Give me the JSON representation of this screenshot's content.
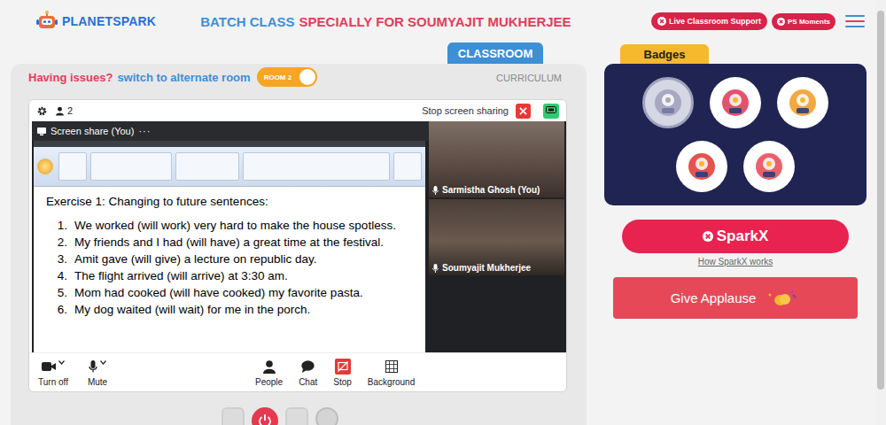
{
  "header": {
    "logo": "PLANETSPARK",
    "title": [
      {
        "text": "BATCH CLASS",
        "color": "#3d8fd6"
      },
      {
        "text": "SPECIALLY FOR SOUMYAJIT MUKHERJEE",
        "color": "#e23d5c"
      }
    ],
    "support_button": "Live Classroom Support",
    "moments_button": "PS Moments"
  },
  "tabs": [
    {
      "label": "CLASSROOM",
      "selected": true
    },
    {
      "label": "CURRICULUM",
      "selected": false
    }
  ],
  "room_switch": {
    "prompt": "Having issues?",
    "link": "switch to alternate room",
    "toggle_label": "ROOM 2",
    "on": true
  },
  "call": {
    "participants_count": "2",
    "share_action": "Stop screen sharing",
    "share_label": "Screen share (You)",
    "share_menu": "···",
    "document": {
      "heading": "Exercise 1: Changing to future sentences:",
      "items": [
        {
          "number": "1.",
          "text": "We worked (will work) very hard to make the house spotless."
        },
        {
          "number": "2.",
          "text": "My friends and I had (will have) a great time at the festival."
        },
        {
          "number": "3.",
          "text": "Amit gave (will give) a lecture on republic day."
        },
        {
          "number": "4.",
          "text": "The flight arrived (will arrive) at 3:30 am."
        },
        {
          "number": "5.",
          "text": "Mom had cooked (will have cooked) my favorite pasta."
        },
        {
          "number": "6.",
          "text": "My dog waited (will wait) for me in the porch."
        }
      ]
    },
    "tiles": [
      {
        "name": "Sarmistha Ghosh (You)"
      },
      {
        "name": "Soumyajit Mukherjee"
      }
    ],
    "controls": [
      {
        "label": "Turn off",
        "kind": "dropdown"
      },
      {
        "label": "Mute",
        "kind": "dropdown"
      },
      {
        "label": "People",
        "kind": "plain"
      },
      {
        "label": "Chat",
        "kind": "plain"
      },
      {
        "label": "Stop",
        "kind": "alert"
      },
      {
        "label": "Background",
        "kind": "plain"
      }
    ]
  },
  "badges": {
    "title": "Badges",
    "items": [
      {
        "earned": false,
        "color": "#7a7aa0"
      },
      {
        "earned": true,
        "color": "#e0405e"
      },
      {
        "earned": true,
        "color": "#f0a030"
      },
      {
        "earned": true,
        "color": "#e2403c"
      },
      {
        "earned": true,
        "color": "#e8505c"
      }
    ]
  },
  "sparkx": {
    "button": "SparkX",
    "help_link": "How SparkX works"
  },
  "applause": {
    "button": "Give Applause"
  }
}
